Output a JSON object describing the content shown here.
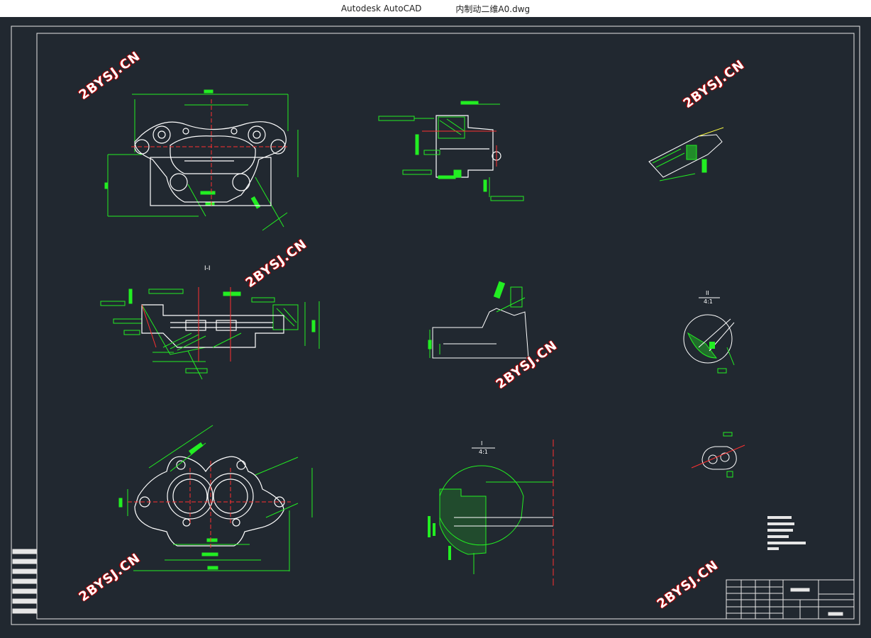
{
  "window": {
    "app_name": "Autodesk AutoCAD",
    "file_name": "内制动二维A0.dwg"
  },
  "drawing": {
    "watermark": "2BYSJ.CN",
    "view_label_top": "I-I",
    "detail_label_1": "II",
    "detail_scale_1": "4:1",
    "detail_label_2": "I",
    "detail_scale_2": "4:1"
  },
  "colors": {
    "background": "#212830",
    "frame": "#e6e6e6",
    "geometry": "#ffffff",
    "dimension": "#22ee22",
    "centerline": "#ff3030"
  }
}
